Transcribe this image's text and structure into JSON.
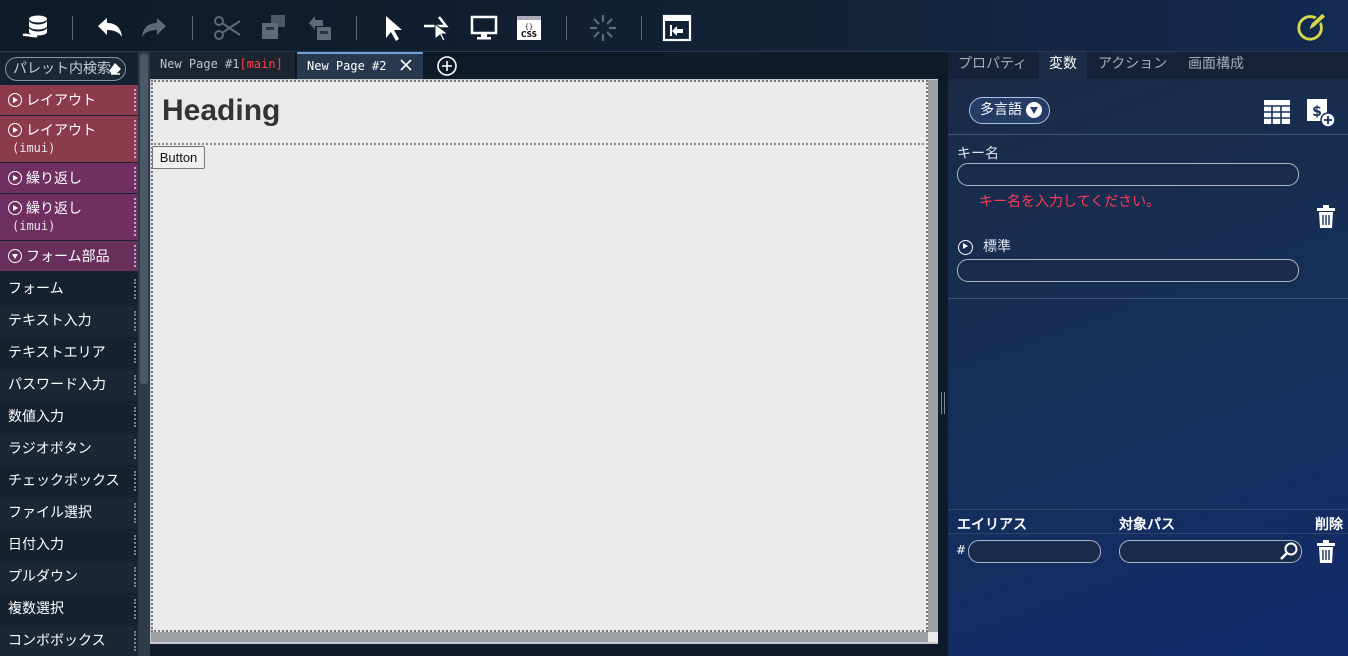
{
  "toolbar": {
    "buttons": [
      "app-logo-icon",
      "undo-icon",
      "redo-icon",
      "cut-icon",
      "copy-icon",
      "paste-icon",
      "select-icon",
      "hover-cursor-icon",
      "monitor-icon",
      "css-icon",
      "spinner-icon",
      "window-icon",
      "edit-icon"
    ],
    "css_label": "CSS"
  },
  "palette": {
    "search_placeholder": "パレット内検索",
    "categories": [
      {
        "label": "レイアウト",
        "sub": ""
      },
      {
        "label": "レイアウト",
        "sub": "(imui)"
      },
      {
        "label": "繰り返し",
        "sub": ""
      },
      {
        "label": "繰り返し",
        "sub": "(imui)"
      },
      {
        "label": "フォーム部品",
        "sub": ""
      }
    ],
    "items": [
      "フォーム",
      "テキスト入力",
      "テキストエリア",
      "パスワード入力",
      "数値入力",
      "ラジオボタン",
      "チェックボックス",
      "ファイル選択",
      "日付入力",
      "プルダウン",
      "複数選択",
      "コンボボックス"
    ]
  },
  "tabs": {
    "page1": "New Page #1",
    "page1_tag": "[main]",
    "page2": "New Page #2"
  },
  "canvas": {
    "heading": "Heading",
    "button": "Button"
  },
  "panel": {
    "tabs": [
      "プロパティ",
      "変数",
      "アクション",
      "画面構成"
    ],
    "language_button": "多言語",
    "key_label": "キー名",
    "key_value": "",
    "key_error": "キー名を入力してください。",
    "standard_label": "標準",
    "standard_value": "",
    "alias_header": "エイリアス",
    "target_path_header": "対象パス",
    "delete_header": "削除",
    "hash": "#"
  },
  "colors": {
    "layout_category": "#8c3a4e",
    "repeat_category": "#6f2f63",
    "form_category": "#672f5c",
    "error_text": "#ff3b56",
    "main_tag": "#ff4040"
  }
}
